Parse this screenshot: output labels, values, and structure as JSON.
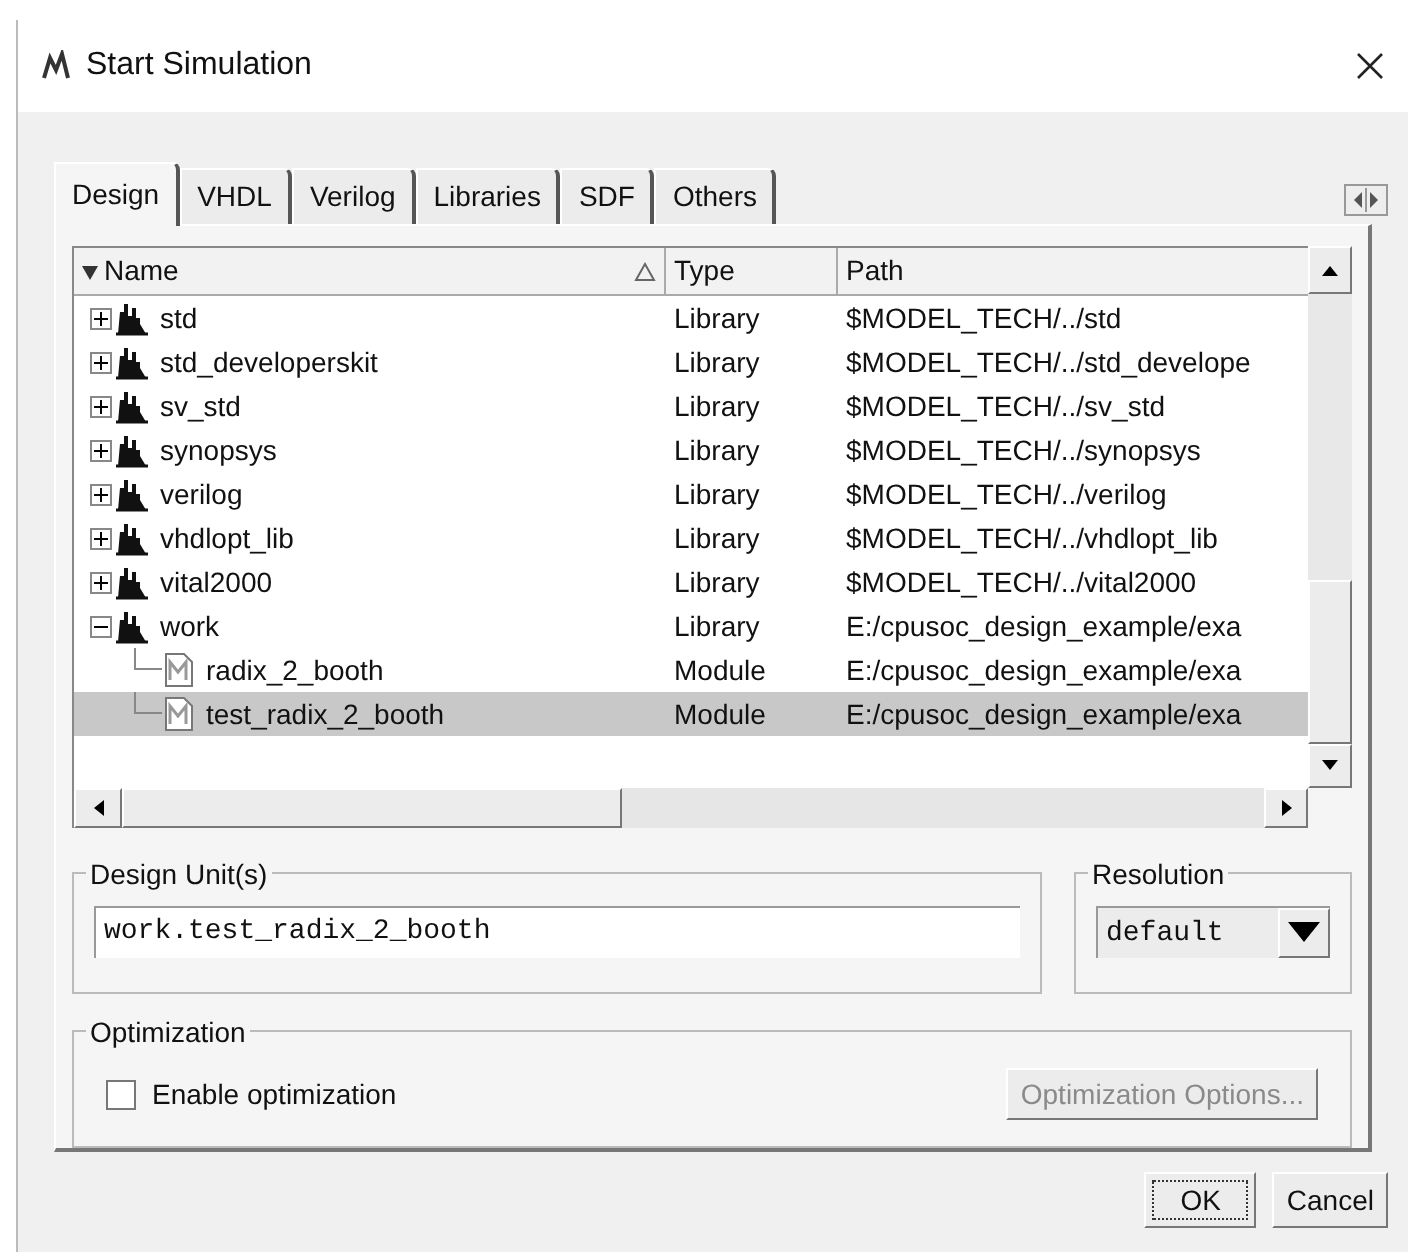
{
  "window": {
    "title": "Start Simulation"
  },
  "tabs": [
    {
      "label": "Design",
      "selected": true
    },
    {
      "label": "VHDL",
      "selected": false
    },
    {
      "label": "Verilog",
      "selected": false
    },
    {
      "label": "Libraries",
      "selected": false
    },
    {
      "label": "SDF",
      "selected": false
    },
    {
      "label": "Others",
      "selected": false
    }
  ],
  "table": {
    "columns": [
      "Name",
      "Type",
      "Path"
    ],
    "rows": [
      {
        "kind": "library",
        "name": "std",
        "type": "Library",
        "path": "$MODEL_TECH/../std",
        "expanded": false,
        "selected": false
      },
      {
        "kind": "library",
        "name": "std_developerskit",
        "type": "Library",
        "path": "$MODEL_TECH/../std_develope",
        "expanded": false,
        "selected": false
      },
      {
        "kind": "library",
        "name": "sv_std",
        "type": "Library",
        "path": "$MODEL_TECH/../sv_std",
        "expanded": false,
        "selected": false
      },
      {
        "kind": "library",
        "name": "synopsys",
        "type": "Library",
        "path": "$MODEL_TECH/../synopsys",
        "expanded": false,
        "selected": false
      },
      {
        "kind": "library",
        "name": "verilog",
        "type": "Library",
        "path": "$MODEL_TECH/../verilog",
        "expanded": false,
        "selected": false
      },
      {
        "kind": "library",
        "name": "vhdlopt_lib",
        "type": "Library",
        "path": "$MODEL_TECH/../vhdlopt_lib",
        "expanded": false,
        "selected": false
      },
      {
        "kind": "library",
        "name": "vital2000",
        "type": "Library",
        "path": "$MODEL_TECH/../vital2000",
        "expanded": false,
        "selected": false
      },
      {
        "kind": "library",
        "name": "work",
        "type": "Library",
        "path": "E:/cpusoc_design_example/exa",
        "expanded": true,
        "selected": false,
        "children": [
          {
            "kind": "module",
            "name": "radix_2_booth",
            "type": "Module",
            "path": "E:/cpusoc_design_example/exa",
            "selected": false
          },
          {
            "kind": "module",
            "name": "test_radix_2_booth",
            "type": "Module",
            "path": "E:/cpusoc_design_example/exa",
            "selected": true
          }
        ]
      }
    ]
  },
  "design_unit": {
    "label": "Design Unit(s)",
    "value": "work.test_radix_2_booth"
  },
  "resolution": {
    "label": "Resolution",
    "value": "default"
  },
  "optimization": {
    "label": "Optimization",
    "checkbox": {
      "label": "Enable optimization",
      "checked": false
    },
    "options_button": {
      "label": "Optimization Options...",
      "disabled": true
    }
  },
  "buttons": [
    "OK",
    "Cancel"
  ]
}
